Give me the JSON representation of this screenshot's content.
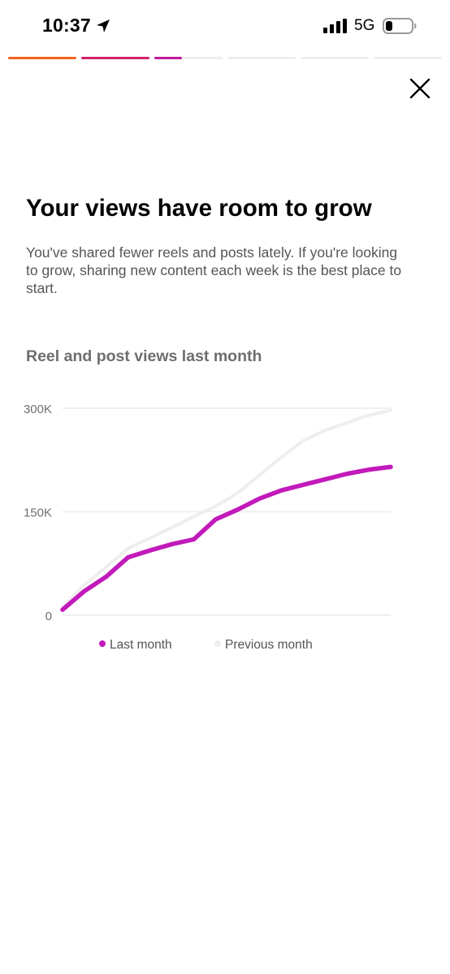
{
  "status_bar": {
    "time": "10:37",
    "network": "5G",
    "icons": [
      "location-arrow-icon",
      "cellular-signal-icon",
      "battery-icon"
    ]
  },
  "story_progress": {
    "segments": [
      {
        "fill": 1.0,
        "color": "#f0631e"
      },
      {
        "fill": 1.0,
        "color": "#d41f6c"
      },
      {
        "fill": 0.4,
        "color": "#c1189c"
      },
      {
        "fill": 0,
        "color": "#efefef"
      },
      {
        "fill": 0,
        "color": "#efefef"
      },
      {
        "fill": 0,
        "color": "#efefef"
      }
    ]
  },
  "close_icon": "close-icon",
  "headline": "Your views have room to grow",
  "description": "You've shared fewer reels and posts lately. If you're looking to grow, sharing new content each week is the best place to start.",
  "chart_title": "Reel and post views last month",
  "chart_data": {
    "type": "line",
    "title": "Reel and post views last month",
    "ylim": [
      0,
      300000
    ],
    "y_ticks": [
      {
        "value": 0,
        "label": "0"
      },
      {
        "value": 150000,
        "label": "150K"
      },
      {
        "value": 300000,
        "label": "300K"
      }
    ],
    "grid": true,
    "legend_position": "bottom",
    "x": [
      1,
      2,
      3,
      4,
      5,
      6,
      7,
      8,
      9,
      10,
      11,
      12,
      13,
      14,
      15,
      16
    ],
    "series": [
      {
        "name": "Last month",
        "color": "#c21aba",
        "values": [
          8000,
          35000,
          56000,
          84000,
          94000,
          103000,
          110000,
          139000,
          153000,
          169000,
          181000,
          189000,
          197000,
          205000,
          211000,
          215000
        ]
      },
      {
        "name": "Previous month",
        "color": "#eeeeee",
        "values": [
          12000,
          44000,
          70000,
          97000,
          112000,
          127000,
          143000,
          158000,
          177000,
          203000,
          229000,
          253000,
          268000,
          279000,
          290000,
          297000
        ]
      }
    ]
  }
}
